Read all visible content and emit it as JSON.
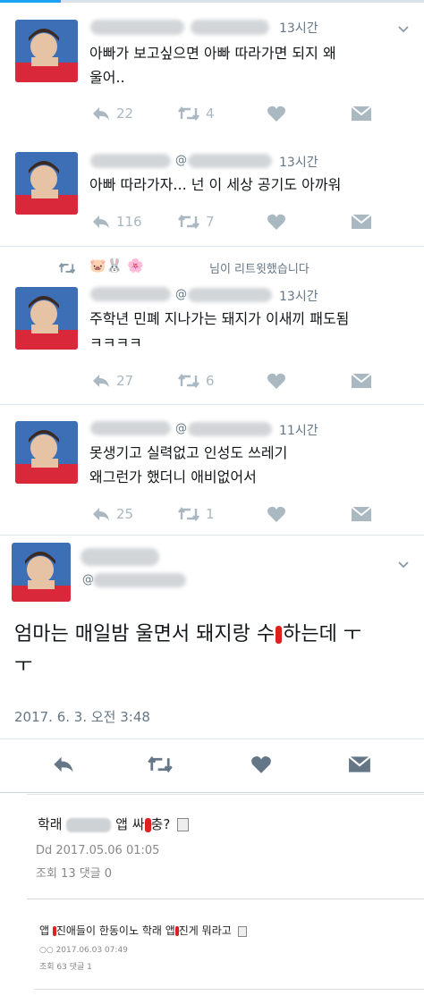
{
  "tweets": [
    {
      "time": "13시간",
      "text": "아빠가 보고싶으면 아빠 따라가면 되지 왜\n울어..",
      "reply_count": "22",
      "retweet_count": "4"
    },
    {
      "at": "@",
      "time": "13시간",
      "text": "아빠 따라가자... 넌 이 세상 공기도 아까워",
      "reply_count": "116",
      "retweet_count": "7"
    },
    {
      "retweeted_by": "님이 리트윗했습니다",
      "retweeted_by_emoji": "🐷🐰 🌸",
      "at": "@",
      "time": "13시간",
      "text": "주학년 민폐 지나가는 돼지가 이새끼 패도됨\nㅋㅋㅋㅋ",
      "reply_count": "27",
      "retweet_count": "6"
    },
    {
      "at": "@",
      "time": "11시간",
      "text": "못생기고 실력없고 인성도 쓰레기\n왜그런가 했더니 애비없어서",
      "reply_count": "25",
      "retweet_count": "1"
    }
  ],
  "focus_tweet": {
    "at": "@",
    "text_1": "엄마는 매일밤 울면서 돼지랑 수",
    "text_2": "하는데 ㅜ",
    "text_3": "ㅜ",
    "date": "2017. 6. 3. 오전 3:48"
  },
  "posts": [
    {
      "title_pre": "학래",
      "title_mid": "앱 싸",
      "title_post": "충?",
      "date": "Dd 2017.05.06 01:05",
      "stats": "조회 13 댓글 0"
    },
    {
      "title_a": "앱",
      "title_b": "진애들이 한동이노 학래 앱",
      "title_c": "진게 뭐라고",
      "meta_date": "○○ 2017.06.03 07:49",
      "stats": "조회 63 댓글 1"
    }
  ],
  "colors": {
    "accent": "#1da1f2",
    "icon_gray": "#aab8c2",
    "text_dark": "#14171a",
    "text_gray": "#657786"
  }
}
